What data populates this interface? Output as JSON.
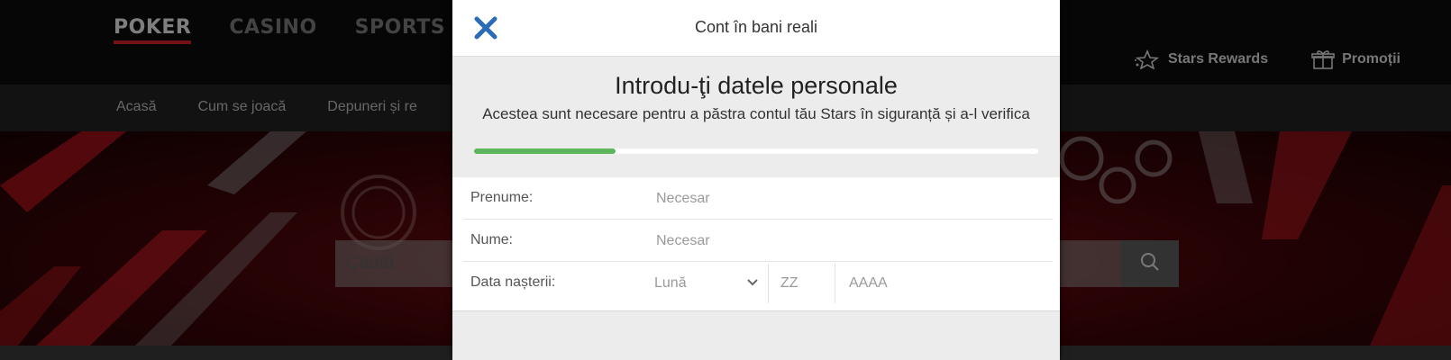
{
  "site": {
    "brand_tabs": [
      {
        "label": "POKER",
        "active": true
      },
      {
        "label": "CASINO",
        "active": false
      },
      {
        "label": "SPORTS",
        "active": false
      }
    ],
    "top_links": [
      {
        "label": "Stars Rewards",
        "icon": "star-icon"
      },
      {
        "label": "Promoții",
        "icon": "gift-icon"
      }
    ],
    "subnav": [
      "Acasă",
      "Cum se joacă",
      "Depuneri și re"
    ],
    "search_placeholder": "Caută",
    "accent_color": "#d21f2a"
  },
  "modal": {
    "title": "Cont în bani reali",
    "step_title": "Introdu-ţi datele personale",
    "step_subtitle": "Acestea sunt necesare pentru a păstra contul tău Stars în siguranță și a-l verifica",
    "progress_fraction": 0.25,
    "progress_color": "#5db55b",
    "fields": {
      "first_name": {
        "label": "Prenume:",
        "placeholder": "Necesar"
      },
      "last_name": {
        "label": "Nume:",
        "placeholder": "Necesar"
      },
      "birth_date": {
        "label": "Data nașterii:",
        "month_placeholder": "Lună",
        "day_placeholder": "ZZ",
        "year_placeholder": "AAAA"
      }
    }
  }
}
